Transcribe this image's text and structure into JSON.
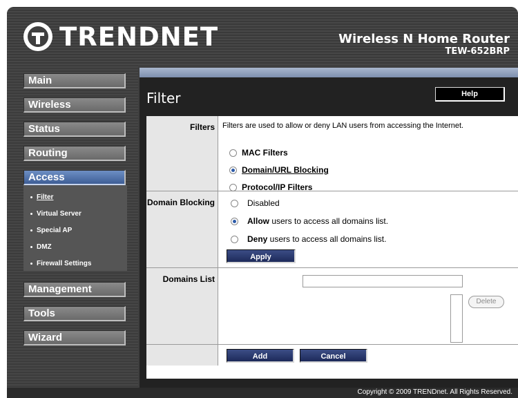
{
  "header": {
    "brand": "TRENDNET",
    "product_name": "Wireless N Home Router",
    "model": "TEW-652BRP"
  },
  "nav": {
    "items": [
      {
        "label": "Main"
      },
      {
        "label": "Wireless"
      },
      {
        "label": "Status"
      },
      {
        "label": "Routing"
      },
      {
        "label": "Access"
      },
      {
        "label": "Management"
      },
      {
        "label": "Tools"
      },
      {
        "label": "Wizard"
      }
    ],
    "active": "Access",
    "submenu": [
      {
        "label": "Filter",
        "selected": true
      },
      {
        "label": "Virtual Server"
      },
      {
        "label": "Special AP"
      },
      {
        "label": "DMZ"
      },
      {
        "label": "Firewall Settings"
      }
    ]
  },
  "main": {
    "title": "Filter",
    "help_label": "Help",
    "filters": {
      "label": "Filters",
      "description": "Filters are used to allow or deny LAN users from accessing the Internet.",
      "options": [
        {
          "label": "MAC Filters",
          "checked": false
        },
        {
          "label": "Domain/URL Blocking",
          "checked": true
        },
        {
          "label": "Protocol/IP Filters",
          "checked": false
        }
      ]
    },
    "domain_blocking": {
      "label": "Domain Blocking",
      "options": [
        {
          "bold": "",
          "text": "Disabled",
          "checked": false
        },
        {
          "bold": "Allow",
          "text": " users to access all domains list.",
          "checked": true
        },
        {
          "bold": "Deny",
          "text": " users to access all domains list.",
          "checked": false
        }
      ],
      "apply_label": "Apply"
    },
    "domains_list": {
      "label": "Domains List",
      "input_value": "",
      "delete_label": "Delete"
    },
    "add_label": "Add",
    "cancel_label": "Cancel"
  },
  "footer": {
    "copyright": "Copyright © 2009 TRENDnet. All Rights Reserved."
  },
  "colors": {
    "frame": "#3f3f3f",
    "active_nav": "#3e5e96",
    "button_dark": "#1d2a5a",
    "radio_selected": "#2c5aa8"
  }
}
